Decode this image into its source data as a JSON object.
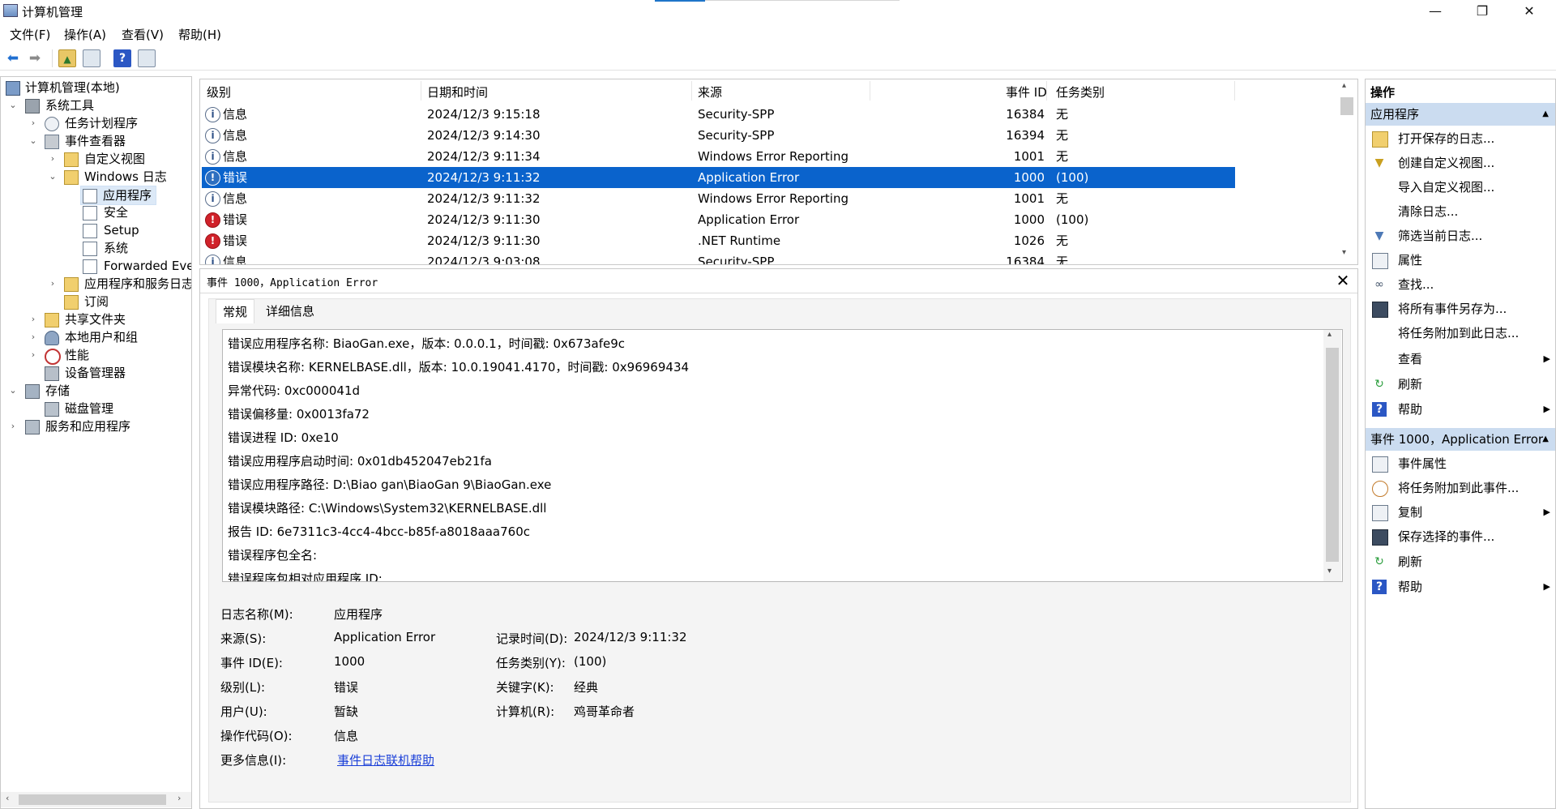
{
  "window": {
    "title": "计算机管理",
    "minimize": "—",
    "maximize": "❐",
    "close": "✕"
  },
  "menu": [
    "文件(F)",
    "操作(A)",
    "查看(V)",
    "帮助(H)"
  ],
  "toolbar": {
    "back_icon": "arrow-left-icon",
    "forward_icon": "arrow-right-icon",
    "help_label": "?"
  },
  "tree": [
    {
      "label": "计算机管理(本地)"
    },
    {
      "label": "系统工具"
    },
    {
      "label": "任务计划程序"
    },
    {
      "label": "事件查看器"
    },
    {
      "label": "自定义视图"
    },
    {
      "label": "Windows 日志"
    },
    {
      "label": "应用程序"
    },
    {
      "label": "安全"
    },
    {
      "label": "Setup"
    },
    {
      "label": "系统"
    },
    {
      "label": "Forwarded Even"
    },
    {
      "label": "应用程序和服务日志"
    },
    {
      "label": "订阅"
    },
    {
      "label": "共享文件夹"
    },
    {
      "label": "本地用户和组"
    },
    {
      "label": "性能"
    },
    {
      "label": "设备管理器"
    },
    {
      "label": "存储"
    },
    {
      "label": "磁盘管理"
    },
    {
      "label": "服务和应用程序"
    }
  ],
  "list": {
    "columns": [
      "级别",
      "日期和时间",
      "来源",
      "事件 ID",
      "任务类别"
    ],
    "rows": [
      {
        "level": "信息",
        "datetime": "2024/12/3 9:15:18",
        "source": "Security-SPP",
        "event_id": "16384",
        "category": "无"
      },
      {
        "level": "信息",
        "datetime": "2024/12/3 9:14:30",
        "source": "Security-SPP",
        "event_id": "16394",
        "category": "无"
      },
      {
        "level": "信息",
        "datetime": "2024/12/3 9:11:34",
        "source": "Windows Error Reporting",
        "event_id": "1001",
        "category": "无"
      },
      {
        "level": "错误",
        "datetime": "2024/12/3 9:11:32",
        "source": "Application Error",
        "event_id": "1000",
        "category": "(100)"
      },
      {
        "level": "信息",
        "datetime": "2024/12/3 9:11:32",
        "source": "Windows Error Reporting",
        "event_id": "1001",
        "category": "无"
      },
      {
        "level": "错误",
        "datetime": "2024/12/3 9:11:30",
        "source": "Application Error",
        "event_id": "1000",
        "category": "(100)"
      },
      {
        "level": "错误",
        "datetime": "2024/12/3 9:11:30",
        "source": ".NET Runtime",
        "event_id": "1026",
        "category": "无"
      },
      {
        "level": "信息",
        "datetime": "2024/12/3 9:03:08",
        "source": "Security-SPP",
        "event_id": "16384",
        "category": "无"
      }
    ]
  },
  "detail": {
    "title": "事件 1000，Application Error",
    "close": "✕",
    "tabs": [
      "常规",
      "详细信息"
    ],
    "description": [
      "错误应用程序名称: BiaoGan.exe，版本: 0.0.0.1，时间戳: 0x673afe9c",
      "错误模块名称: KERNELBASE.dll，版本: 10.0.19041.4170，时间戳: 0x96969434",
      "异常代码: 0xc000041d",
      "错误偏移量: 0x0013fa72",
      "错误进程 ID: 0xe10",
      "错误应用程序启动时间: 0x01db452047eb21fa",
      "错误应用程序路径: D:\\Biao gan\\BiaoGan 9\\BiaoGan.exe",
      "错误模块路径: C:\\Windows\\System32\\KERNELBASE.dll",
      "报告 ID: 6e7311c3-4cc4-4bcc-b85f-a8018aaa760c",
      "错误程序包全名:",
      "错误程序包相对应用程序 ID:"
    ],
    "fields": {
      "log_name_label": "日志名称(M):",
      "log_name": "应用程序",
      "source_label": "来源(S):",
      "source": "Application Error",
      "logged_label": "记录时间(D):",
      "logged": "2024/12/3 9:11:32",
      "event_id_label": "事件 ID(E):",
      "event_id": "1000",
      "task_label": "任务类别(Y):",
      "task": "(100)",
      "level_label": "级别(L):",
      "level": "错误",
      "keywords_label": "关键字(K):",
      "keywords": "经典",
      "user_label": "用户(U):",
      "user": "暂缺",
      "computer_label": "计算机(R):",
      "computer": "鸡哥革命者",
      "opcode_label": "操作代码(O):",
      "opcode": "信息",
      "more_info_label": "更多信息(I):",
      "more_info_link": "事件日志联机帮助"
    }
  },
  "actions": {
    "title": "操作",
    "group1": "应用程序",
    "group1_items": [
      "打开保存的日志...",
      "创建自定义视图...",
      "导入自定义视图...",
      "清除日志...",
      "筛选当前日志...",
      "属性",
      "查找...",
      "将所有事件另存为...",
      "将任务附加到此日志...",
      "查看",
      "刷新",
      "帮助"
    ],
    "group2": "事件 1000，Application Error",
    "group2_items": [
      "事件属性",
      "将任务附加到此事件...",
      "复制",
      "保存选择的事件...",
      "刷新",
      "帮助"
    ]
  },
  "colors": {
    "selection": "#0a63cc",
    "action_group": "#cbdcf0",
    "link": "#1a3fd8"
  }
}
